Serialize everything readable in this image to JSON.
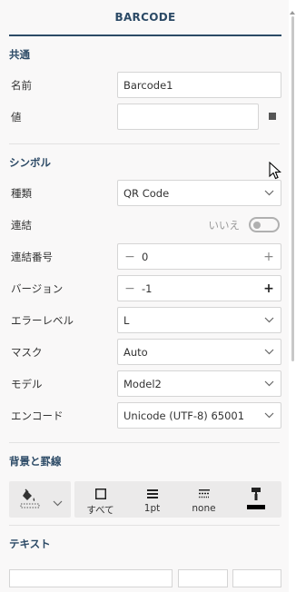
{
  "tab": {
    "title": "BARCODE"
  },
  "common": {
    "heading": "共通",
    "name_label": "名前",
    "name_value": "Barcode1",
    "value_label": "値",
    "value_value": ""
  },
  "symbol": {
    "heading": "シンボル",
    "type_label": "種類",
    "type_value": "QR Code",
    "link_label": "連結",
    "link_toggle_text": "いいえ",
    "link_enabled": false,
    "link_number_label": "連結番号",
    "link_number_value": "0",
    "version_label": "バージョン",
    "version_value": "-1",
    "error_level_label": "エラーレベル",
    "error_level_value": "L",
    "mask_label": "マスク",
    "mask_value": "Auto",
    "model_label": "モデル",
    "model_value": "Model2",
    "encode_label": "エンコード",
    "encode_value": "Unicode (UTF-8) 65001"
  },
  "background": {
    "heading": "背景と罫線",
    "border_all_label": "すべて",
    "border_width_label": "1pt",
    "border_style_label": "none"
  },
  "text": {
    "heading": "テキスト"
  },
  "icons": {
    "stepper_minus": "−",
    "stepper_plus": "+"
  },
  "colors": {
    "accent": "#2c4a66",
    "panel_bg": "#f9f8f8",
    "border_color_swatch": "#000000"
  }
}
